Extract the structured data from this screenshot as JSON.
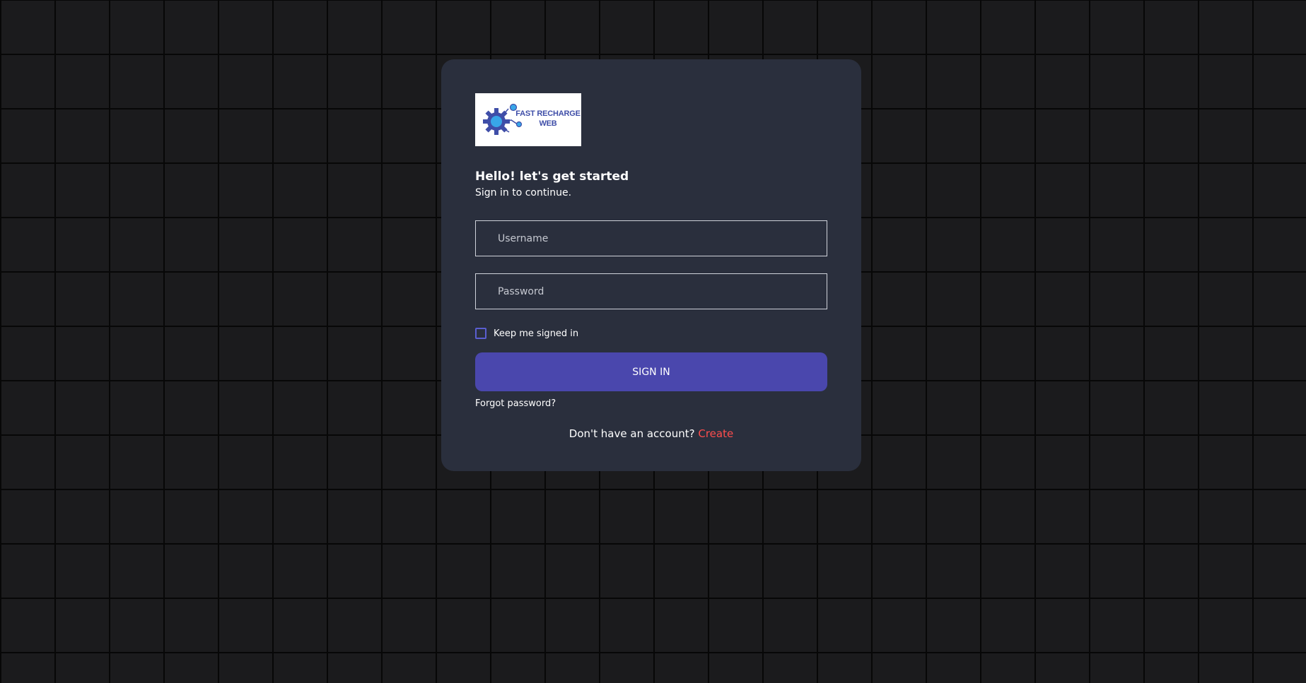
{
  "logo": {
    "text_line1": "FAST RECHARGE",
    "text_line2": "WEB",
    "icon": "gear-circuit-icon",
    "colors": {
      "brand_blue": "#3f4ea8",
      "accent_cyan": "#38a6e8"
    }
  },
  "heading": {
    "title": "Hello! let's get started",
    "subtitle": "Sign in to continue."
  },
  "form": {
    "username_placeholder": "Username",
    "password_placeholder": "Password",
    "remember_label": "Keep me signed in",
    "remember_checked": false,
    "submit_label": "SIGN IN",
    "forgot_label": "Forgot password?"
  },
  "signup": {
    "prompt": "Don't have an account?",
    "link_label": "Create"
  },
  "colors": {
    "page_background": "#1b1b1d",
    "card_background": "#2a2f3d",
    "primary_button": "#4a47ad",
    "link_accent": "#ff4d4d"
  }
}
